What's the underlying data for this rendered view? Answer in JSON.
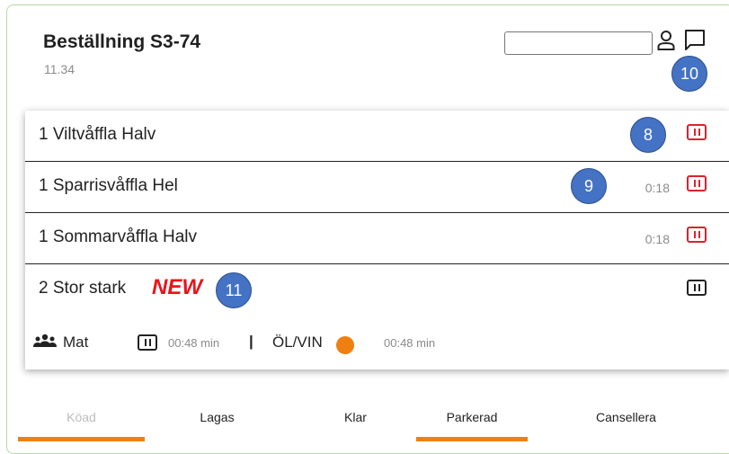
{
  "order": {
    "title": "Beställning S3-74",
    "time": "11.34"
  },
  "header": {
    "search_value": "",
    "person_icon": "person-icon",
    "chat_icon": "chat-icon",
    "chat_badge": "10"
  },
  "items": [
    {
      "label": "1 Viltvåffla Halv",
      "time": "",
      "badge": "8",
      "pause_color": "#d9232e"
    },
    {
      "label": "1 Sparrisvåffla Hel",
      "time": "0:18",
      "badge": "9",
      "pause_color": "#d9232e"
    },
    {
      "label": "1 Sommarvåffla Halv",
      "time": "0:18",
      "badge": "",
      "pause_color": "#d9232e"
    },
    {
      "label": "2 Stor stark",
      "new_tag": "NEW",
      "time": "",
      "badge": "11",
      "pause_color": "#222222"
    }
  ],
  "summary": {
    "group_icon": "group-icon",
    "mat_label": "Mat",
    "mat_time": "00:48 min",
    "separator": "|",
    "drinks_label": "ÖL/VIN",
    "drinks_time": "00:48 min",
    "drinks_status_color": "#f07f12"
  },
  "tabs": [
    {
      "label": "Köad",
      "active": true,
      "dimmed": true
    },
    {
      "label": "Lagas",
      "active": false,
      "dimmed": false
    },
    {
      "label": "Klar",
      "active": false,
      "dimmed": false
    },
    {
      "label": "Parkerad",
      "active": true,
      "dimmed": false
    },
    {
      "label": "Cansellera",
      "active": false,
      "dimmed": false
    }
  ],
  "colors": {
    "accent": "#f07f12",
    "badge": "#4472c4",
    "alert": "#d9232e",
    "frame_border": "#b5dba0"
  }
}
